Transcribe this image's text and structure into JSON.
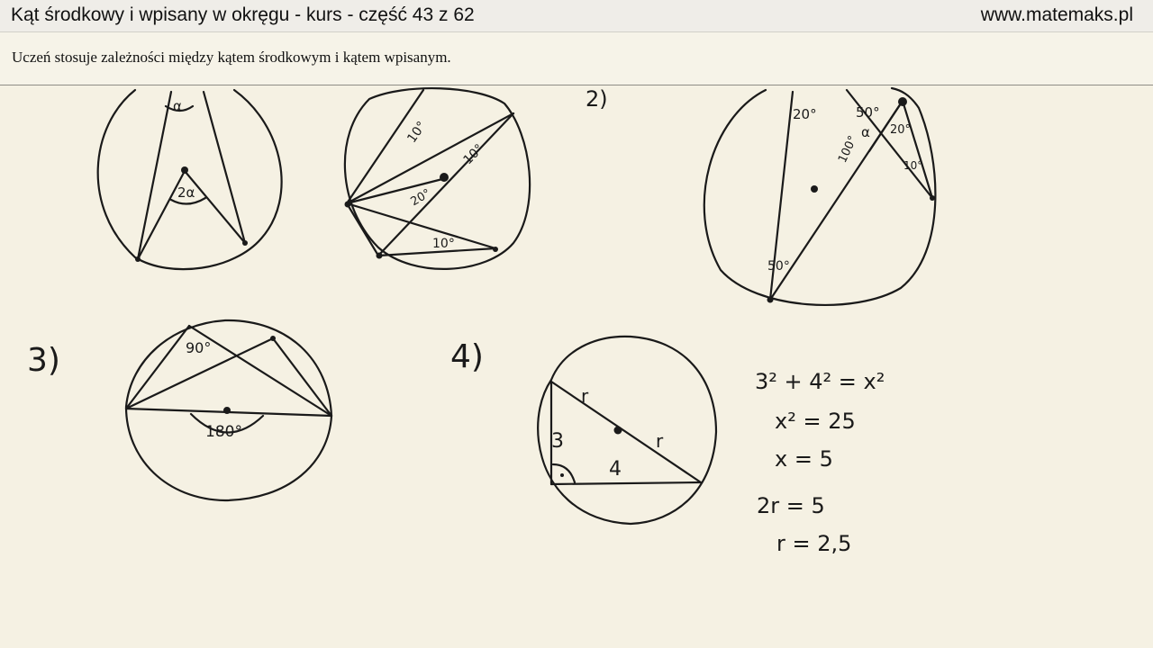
{
  "header": {
    "course_title": "Kąt środkowy i wpisany w okręgu - kurs - część 43 z 62",
    "site_url": "www.matemaks.pl"
  },
  "objective": {
    "text": "Uczeń stosuje zależności między kątem środkowym i kątem wpisanym."
  },
  "board": {
    "fig1": {
      "inscribed_angle": "α",
      "central_angle": "2α"
    },
    "fig2": {
      "angles": [
        "10°",
        "10°",
        "20°",
        "10°"
      ]
    },
    "problem2": {
      "number": "2)",
      "angles": [
        "20°",
        "50°",
        "α",
        "20°",
        "100°",
        "10°",
        "50°"
      ]
    },
    "problem3": {
      "number": "3)",
      "angles": [
        "90°",
        "180°"
      ]
    },
    "problem4": {
      "number": "4)",
      "leg_a": "3",
      "leg_b": "4",
      "radius_label": "r",
      "equations": [
        "3² + 4² = x²",
        "x² = 25",
        "x = 5",
        "2r = 5",
        "r = 2,5"
      ]
    }
  }
}
